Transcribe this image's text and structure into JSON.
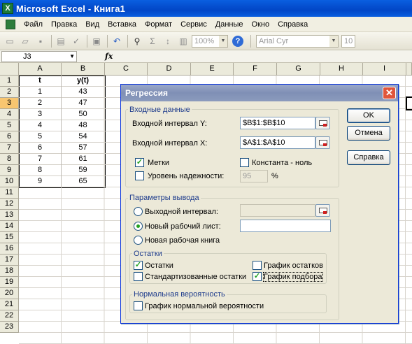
{
  "window": {
    "title": "Microsoft Excel - Книга1",
    "app_icon": "excel-icon"
  },
  "menu": [
    "Файл",
    "Правка",
    "Вид",
    "Вставка",
    "Формат",
    "Сервис",
    "Данные",
    "Окно",
    "Справка"
  ],
  "toolbar": {
    "zoom": "100%",
    "font": "Arial Cyr",
    "font_size": "10"
  },
  "formula_bar": {
    "name_box": "J3",
    "fx": "fx"
  },
  "sheet": {
    "columns": [
      "A",
      "B",
      "C",
      "D",
      "E",
      "F",
      "G",
      "H",
      "I"
    ],
    "rows": [
      "1",
      "2",
      "3",
      "4",
      "5",
      "6",
      "7",
      "8",
      "9",
      "10",
      "11",
      "12",
      "13",
      "14",
      "15",
      "16",
      "17",
      "18",
      "19",
      "20",
      "21",
      "22",
      "23"
    ],
    "active_cell": "J3",
    "header_row": [
      "t",
      "y(t)"
    ],
    "data": [
      [
        "1",
        "43"
      ],
      [
        "2",
        "47"
      ],
      [
        "3",
        "50"
      ],
      [
        "4",
        "48"
      ],
      [
        "5",
        "54"
      ],
      [
        "6",
        "57"
      ],
      [
        "7",
        "61"
      ],
      [
        "8",
        "59"
      ],
      [
        "9",
        "65"
      ]
    ]
  },
  "dialog": {
    "title": "Регрессия",
    "input_group": "Входные данные",
    "y_label": "Входной интервал Y:",
    "y_value": "$B$1:$B$10",
    "x_label": "Входной интервал X:",
    "x_value": "$A$1:$A$10",
    "labels_check": "Метки",
    "labels_checked": true,
    "const_check": "Константа - ноль",
    "const_checked": false,
    "conf_check": "Уровень надежности:",
    "conf_checked": false,
    "conf_value": "95",
    "conf_unit": "%",
    "output_group": "Параметры вывода",
    "out_range": "Выходной интервал:",
    "new_sheet": "Новый рабочий лист:",
    "new_book": "Новая рабочая книга",
    "selected_output": "new_sheet",
    "residuals_group": "Остатки",
    "residuals": "Остатки",
    "residuals_checked": true,
    "std_residuals": "Стандартизованные остатки",
    "std_residuals_checked": false,
    "residual_plot": "График остатков",
    "residual_plot_checked": false,
    "fit_plot": "График подбора",
    "fit_plot_checked": true,
    "normal_group": "Нормальная вероятность",
    "normal_plot": "График нормальной вероятности",
    "normal_plot_checked": false,
    "ok": "OK",
    "cancel": "Отмена",
    "help": "Справка"
  }
}
